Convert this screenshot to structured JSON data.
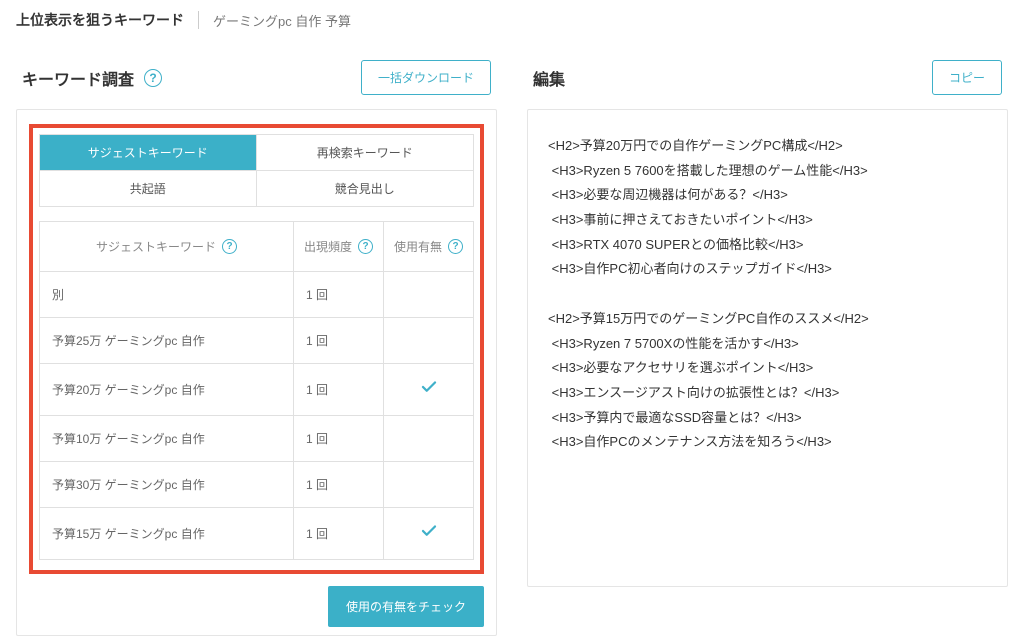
{
  "header": {
    "label": "上位表示を狙うキーワード",
    "keyword": "ゲーミングpc 自作 予算"
  },
  "left_panel": {
    "title": "キーワード調査",
    "download_btn": "一括ダウンロード",
    "tabs": {
      "suggest": "サジェストキーワード",
      "research": "再検索キーワード",
      "cooccur": "共起語",
      "competitor": "競合見出し"
    },
    "table": {
      "cols": {
        "keyword": "サジェストキーワード",
        "freq": "出現頻度",
        "used": "使用有無"
      },
      "rows": [
        {
          "kw": "別",
          "freq": "1 回",
          "used": false
        },
        {
          "kw": "予算25万 ゲーミングpc 自作",
          "freq": "1 回",
          "used": false
        },
        {
          "kw": "予算20万 ゲーミングpc 自作",
          "freq": "1 回",
          "used": true
        },
        {
          "kw": "予算10万 ゲーミングpc 自作",
          "freq": "1 回",
          "used": false
        },
        {
          "kw": "予算30万 ゲーミングpc 自作",
          "freq": "1 回",
          "used": false
        },
        {
          "kw": "予算15万 ゲーミングpc 自作",
          "freq": "1 回",
          "used": true
        }
      ]
    },
    "check_btn": "使用の有無をチェック"
  },
  "right_panel": {
    "title": "編集",
    "copy_btn": "コピー",
    "content": "<H2>予算20万円での自作ゲーミングPC構成</H2>\n <H3>Ryzen 5 7600を搭載した理想のゲーム性能</H3>\n <H3>必要な周辺機器は何がある？</H3>\n <H3>事前に押さえておきたいポイント</H3>\n <H3>RTX 4070 SUPERとの価格比較</H3>\n <H3>自作PC初心者向けのステップガイド</H3>\n\n<H2>予算15万円でのゲーミングPC自作のススメ</H2>\n <H3>Ryzen 7 5700Xの性能を活かす</H3>\n <H3>必要なアクセサリを選ぶポイント</H3>\n <H3>エンスージアスト向けの拡張性とは？</H3>\n <H3>予算内で最適なSSD容量とは？</H3>\n <H3>自作PCのメンテナンス方法を知ろう</H3>"
  }
}
